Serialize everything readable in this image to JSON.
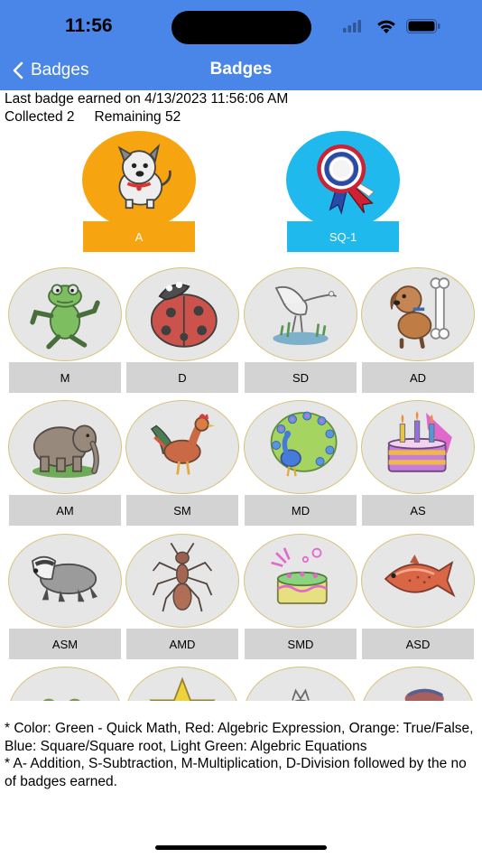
{
  "status": {
    "time": "11:56",
    "icons": [
      "signal-icon",
      "wifi-icon",
      "battery-icon"
    ]
  },
  "nav": {
    "back_label": "Badges",
    "title": "Badges"
  },
  "summary": {
    "last_badge": "Last badge earned on 4/13/2023 11:56:06 AM",
    "collected": "Collected 2",
    "remaining": "Remaining 52"
  },
  "earned_badges": [
    {
      "label": "A",
      "icon": "puppy-icon",
      "color": "#f7a411"
    },
    {
      "label": "SQ-1",
      "icon": "rosette-ribbon-icon",
      "color": "#1fb9ee"
    }
  ],
  "badges": [
    {
      "label": "M",
      "icon": "frog-icon"
    },
    {
      "label": "D",
      "icon": "ladybug-icon"
    },
    {
      "label": "SD",
      "icon": "crane-bird-icon"
    },
    {
      "label": "AD",
      "icon": "dog-with-bone-icon"
    },
    {
      "label": "AM",
      "icon": "elephant-icon"
    },
    {
      "label": "SM",
      "icon": "rooster-icon"
    },
    {
      "label": "MD",
      "icon": "peacock-icon"
    },
    {
      "label": "AS",
      "icon": "birthday-cake-icon"
    },
    {
      "label": "ASM",
      "icon": "badger-icon"
    },
    {
      "label": "AMD",
      "icon": "ant-icon"
    },
    {
      "label": "SMD",
      "icon": "party-cake-icon"
    },
    {
      "label": "ASD",
      "icon": "salmon-fish-icon"
    },
    {
      "label": "",
      "icon": "frog-partial-icon"
    },
    {
      "label": "",
      "icon": "star-partial-icon"
    },
    {
      "label": "",
      "icon": "cat-partial-icon"
    },
    {
      "label": "",
      "icon": "cap-partial-icon"
    }
  ],
  "notes": {
    "line1": "* Color: Green - Quick Math, Red: Algebric Expression, Orange: True/False, Blue: Square/Square root, Light Green: Algebric Equations",
    "line2": "* A- Addition, S-Subtraction, M-Multiplication, D-Division followed by the no of badges earned."
  },
  "colors": {
    "header": "#4a86e8",
    "orange": "#f7a411",
    "blue": "#1fb9ee",
    "locked": "#d3d3d3"
  }
}
